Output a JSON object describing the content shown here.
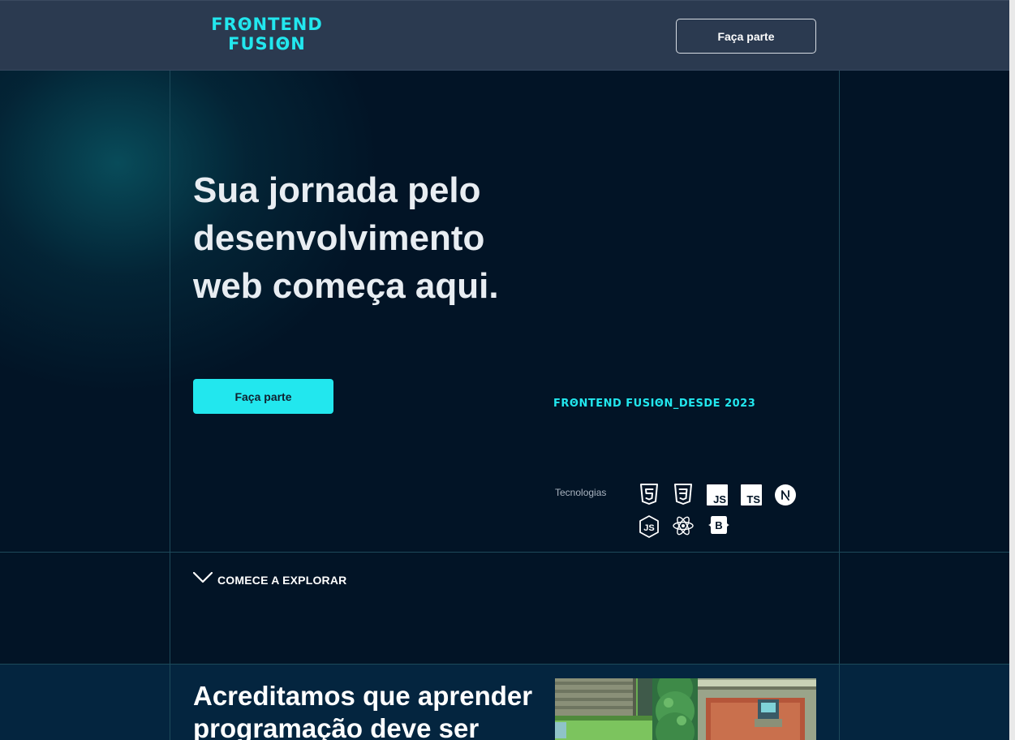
{
  "header": {
    "logo_line1": "FRΘNTEND",
    "logo_line2": "FUSIΘN",
    "cta_label": "Faça parte"
  },
  "hero": {
    "title": "Sua jornada pelo desenvolvimento web começa aqui.",
    "cta_label": "Faça parte",
    "since_text": "FRΘNTEND FUSIΘN_DESDE 2023",
    "technologies_label": "Tecnologias",
    "technologies": [
      {
        "name": "HTML5",
        "icon": "html5-icon"
      },
      {
        "name": "CSS3",
        "icon": "css3-icon"
      },
      {
        "name": "JavaScript",
        "icon": "javascript-icon",
        "badge": "JS"
      },
      {
        "name": "TypeScript",
        "icon": "typescript-icon",
        "badge": "TS"
      },
      {
        "name": "Next.js",
        "icon": "nextjs-icon",
        "badge": "N"
      },
      {
        "name": "Node.js",
        "icon": "nodejs-icon",
        "badge": "JS"
      },
      {
        "name": "React",
        "icon": "react-icon"
      },
      {
        "name": "Bootstrap",
        "icon": "bootstrap-icon",
        "badge": "B"
      }
    ]
  },
  "explore": {
    "label": "COMECE A EXPLORAR",
    "icon": "chevron-down-icon"
  },
  "about": {
    "title": "Acreditamos que aprender programação deve ser",
    "image_icon": "pixel-game-scene-image"
  },
  "colors": {
    "accent": "#22e7ee",
    "background": "#021426",
    "header": "#2b3a50",
    "section": "#04253f"
  }
}
